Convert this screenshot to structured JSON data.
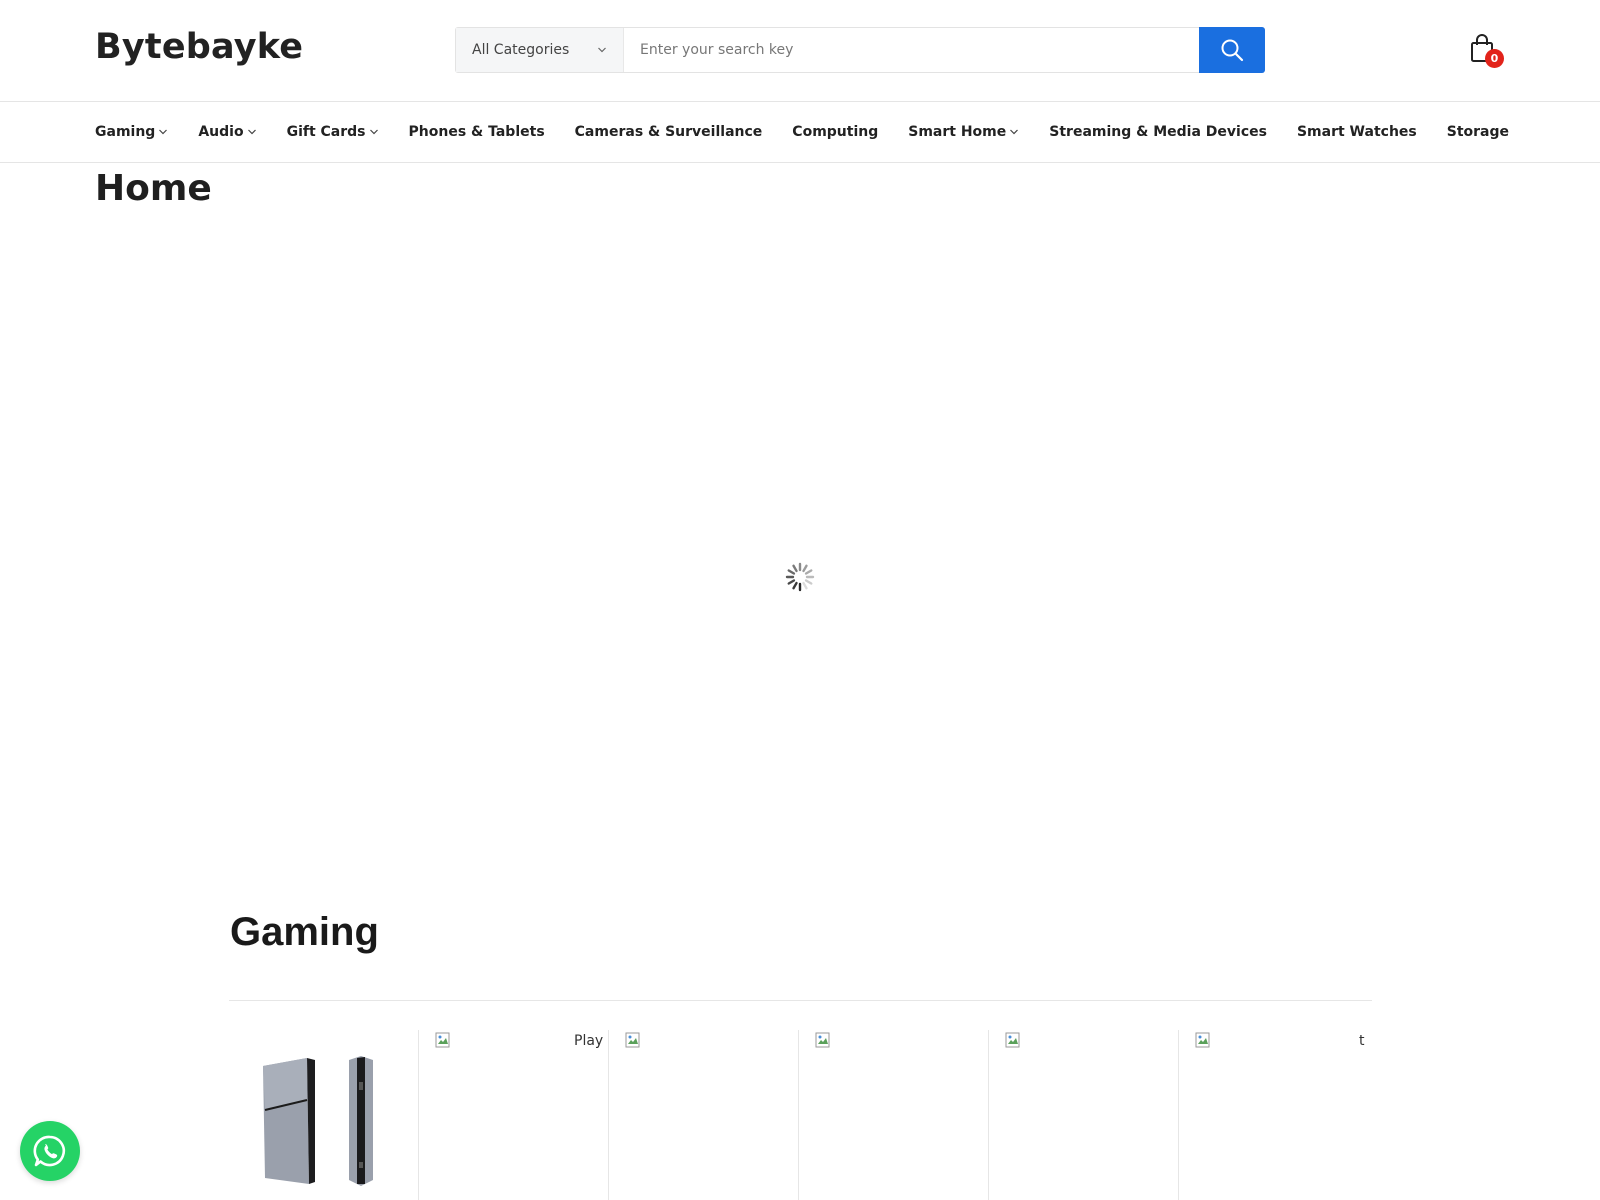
{
  "header": {
    "logo": "Bytebayke",
    "search": {
      "category_selected": "All Categories",
      "placeholder": "Enter your search key",
      "value": ""
    },
    "cart_count": "0",
    "search_button_icon": "search-icon",
    "cart_icon": "shopping-bag-icon"
  },
  "nav": {
    "items": [
      {
        "label": "Gaming",
        "has_dropdown": true
      },
      {
        "label": "Audio",
        "has_dropdown": true
      },
      {
        "label": "Gift Cards",
        "has_dropdown": true
      },
      {
        "label": "Phones & Tablets",
        "has_dropdown": false
      },
      {
        "label": "Cameras & Surveillance",
        "has_dropdown": false
      },
      {
        "label": "Computing",
        "has_dropdown": false
      },
      {
        "label": "Smart Home",
        "has_dropdown": true
      },
      {
        "label": "Streaming & Media Devices",
        "has_dropdown": false
      },
      {
        "label": "Smart Watches",
        "has_dropdown": false
      },
      {
        "label": "Storage",
        "has_dropdown": false
      }
    ]
  },
  "page": {
    "title": "Home",
    "loading_indicator": "spinner-icon"
  },
  "gaming": {
    "title": "Gaming",
    "products": [
      {
        "image": "console-image",
        "alt": ""
      },
      {
        "image": "broken-image-icon",
        "alt": "Play"
      },
      {
        "image": "broken-image-icon",
        "alt": ""
      },
      {
        "image": "broken-image-icon",
        "alt": ""
      },
      {
        "image": "broken-image-icon",
        "alt": ""
      },
      {
        "image": "broken-image-icon",
        "alt": "t"
      }
    ]
  },
  "whatsapp": {
    "icon": "whatsapp-icon"
  },
  "colors": {
    "accent": "#1a6fe0",
    "badge": "#e2231a",
    "whatsapp": "#25d366"
  }
}
